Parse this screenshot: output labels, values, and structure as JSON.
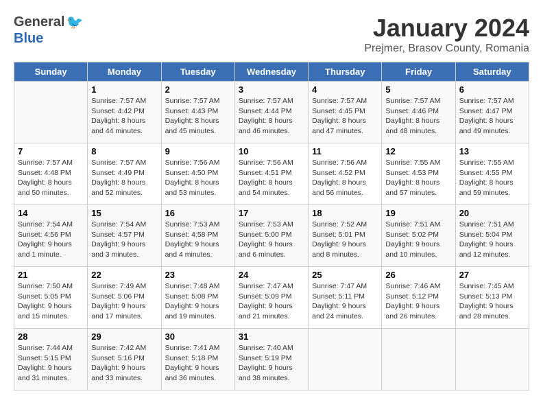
{
  "header": {
    "logo_general": "General",
    "logo_blue": "Blue",
    "title": "January 2024",
    "subtitle": "Prejmer, Brasov County, Romania"
  },
  "weekdays": [
    "Sunday",
    "Monday",
    "Tuesday",
    "Wednesday",
    "Thursday",
    "Friday",
    "Saturday"
  ],
  "weeks": [
    [
      {
        "day": "",
        "info": ""
      },
      {
        "day": "1",
        "info": "Sunrise: 7:57 AM\nSunset: 4:42 PM\nDaylight: 8 hours\nand 44 minutes."
      },
      {
        "day": "2",
        "info": "Sunrise: 7:57 AM\nSunset: 4:43 PM\nDaylight: 8 hours\nand 45 minutes."
      },
      {
        "day": "3",
        "info": "Sunrise: 7:57 AM\nSunset: 4:44 PM\nDaylight: 8 hours\nand 46 minutes."
      },
      {
        "day": "4",
        "info": "Sunrise: 7:57 AM\nSunset: 4:45 PM\nDaylight: 8 hours\nand 47 minutes."
      },
      {
        "day": "5",
        "info": "Sunrise: 7:57 AM\nSunset: 4:46 PM\nDaylight: 8 hours\nand 48 minutes."
      },
      {
        "day": "6",
        "info": "Sunrise: 7:57 AM\nSunset: 4:47 PM\nDaylight: 8 hours\nand 49 minutes."
      }
    ],
    [
      {
        "day": "7",
        "info": "Sunrise: 7:57 AM\nSunset: 4:48 PM\nDaylight: 8 hours\nand 50 minutes."
      },
      {
        "day": "8",
        "info": "Sunrise: 7:57 AM\nSunset: 4:49 PM\nDaylight: 8 hours\nand 52 minutes."
      },
      {
        "day": "9",
        "info": "Sunrise: 7:56 AM\nSunset: 4:50 PM\nDaylight: 8 hours\nand 53 minutes."
      },
      {
        "day": "10",
        "info": "Sunrise: 7:56 AM\nSunset: 4:51 PM\nDaylight: 8 hours\nand 54 minutes."
      },
      {
        "day": "11",
        "info": "Sunrise: 7:56 AM\nSunset: 4:52 PM\nDaylight: 8 hours\nand 56 minutes."
      },
      {
        "day": "12",
        "info": "Sunrise: 7:55 AM\nSunset: 4:53 PM\nDaylight: 8 hours\nand 57 minutes."
      },
      {
        "day": "13",
        "info": "Sunrise: 7:55 AM\nSunset: 4:55 PM\nDaylight: 8 hours\nand 59 minutes."
      }
    ],
    [
      {
        "day": "14",
        "info": "Sunrise: 7:54 AM\nSunset: 4:56 PM\nDaylight: 9 hours\nand 1 minute."
      },
      {
        "day": "15",
        "info": "Sunrise: 7:54 AM\nSunset: 4:57 PM\nDaylight: 9 hours\nand 3 minutes."
      },
      {
        "day": "16",
        "info": "Sunrise: 7:53 AM\nSunset: 4:58 PM\nDaylight: 9 hours\nand 4 minutes."
      },
      {
        "day": "17",
        "info": "Sunrise: 7:53 AM\nSunset: 5:00 PM\nDaylight: 9 hours\nand 6 minutes."
      },
      {
        "day": "18",
        "info": "Sunrise: 7:52 AM\nSunset: 5:01 PM\nDaylight: 9 hours\nand 8 minutes."
      },
      {
        "day": "19",
        "info": "Sunrise: 7:51 AM\nSunset: 5:02 PM\nDaylight: 9 hours\nand 10 minutes."
      },
      {
        "day": "20",
        "info": "Sunrise: 7:51 AM\nSunset: 5:04 PM\nDaylight: 9 hours\nand 12 minutes."
      }
    ],
    [
      {
        "day": "21",
        "info": "Sunrise: 7:50 AM\nSunset: 5:05 PM\nDaylight: 9 hours\nand 15 minutes."
      },
      {
        "day": "22",
        "info": "Sunrise: 7:49 AM\nSunset: 5:06 PM\nDaylight: 9 hours\nand 17 minutes."
      },
      {
        "day": "23",
        "info": "Sunrise: 7:48 AM\nSunset: 5:08 PM\nDaylight: 9 hours\nand 19 minutes."
      },
      {
        "day": "24",
        "info": "Sunrise: 7:47 AM\nSunset: 5:09 PM\nDaylight: 9 hours\nand 21 minutes."
      },
      {
        "day": "25",
        "info": "Sunrise: 7:47 AM\nSunset: 5:11 PM\nDaylight: 9 hours\nand 24 minutes."
      },
      {
        "day": "26",
        "info": "Sunrise: 7:46 AM\nSunset: 5:12 PM\nDaylight: 9 hours\nand 26 minutes."
      },
      {
        "day": "27",
        "info": "Sunrise: 7:45 AM\nSunset: 5:13 PM\nDaylight: 9 hours\nand 28 minutes."
      }
    ],
    [
      {
        "day": "28",
        "info": "Sunrise: 7:44 AM\nSunset: 5:15 PM\nDaylight: 9 hours\nand 31 minutes."
      },
      {
        "day": "29",
        "info": "Sunrise: 7:42 AM\nSunset: 5:16 PM\nDaylight: 9 hours\nand 33 minutes."
      },
      {
        "day": "30",
        "info": "Sunrise: 7:41 AM\nSunset: 5:18 PM\nDaylight: 9 hours\nand 36 minutes."
      },
      {
        "day": "31",
        "info": "Sunrise: 7:40 AM\nSunset: 5:19 PM\nDaylight: 9 hours\nand 38 minutes."
      },
      {
        "day": "",
        "info": ""
      },
      {
        "day": "",
        "info": ""
      },
      {
        "day": "",
        "info": ""
      }
    ]
  ]
}
